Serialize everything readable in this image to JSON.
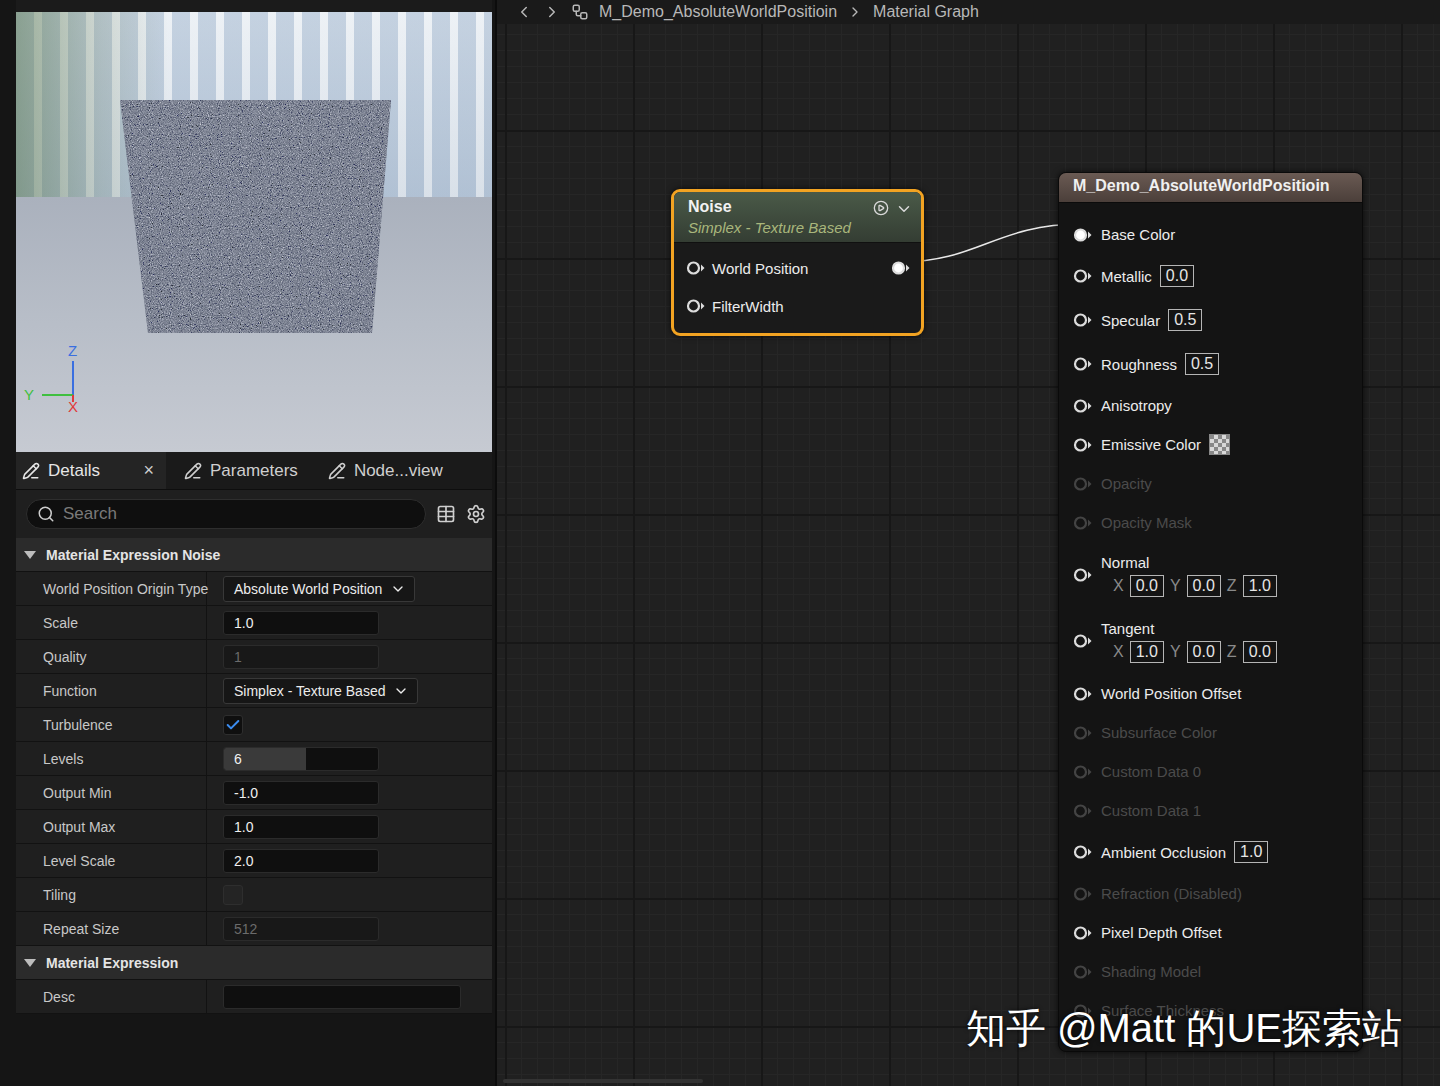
{
  "viewport": {
    "axes": [
      {
        "label": "Z",
        "color": "#3a6fe0"
      },
      {
        "label": "Y",
        "color": "#3fbf3f"
      },
      {
        "label": "X",
        "color": "#e03a3a"
      }
    ]
  },
  "details": {
    "tabs": [
      {
        "label": "Details",
        "selected": true,
        "close": "×"
      },
      {
        "label": "Parameters",
        "selected": false
      },
      {
        "label": "Node...view",
        "selected": false
      }
    ],
    "search": {
      "placeholder": "Search"
    },
    "sections": [
      {
        "title": "Material Expression Noise",
        "expanded": true,
        "rows": [
          {
            "label": "World Position Origin Type",
            "kind": "dropdown",
            "value": "Absolute World Position",
            "disabled": false
          },
          {
            "label": "Scale",
            "kind": "number",
            "value": "1.0",
            "disabled": false
          },
          {
            "label": "Quality",
            "kind": "number",
            "value": "1",
            "disabled": true
          },
          {
            "label": "Function",
            "kind": "dropdown",
            "value": "Simplex - Texture Based",
            "disabled": false
          },
          {
            "label": "Turbulence",
            "kind": "checkbox",
            "checked": true,
            "disabled": false
          },
          {
            "label": "Levels",
            "kind": "slider",
            "value": "6",
            "level": 0.53,
            "disabled": false
          },
          {
            "label": "Output Min",
            "kind": "number",
            "value": "-1.0",
            "disabled": false
          },
          {
            "label": "Output Max",
            "kind": "number",
            "value": "1.0",
            "disabled": false
          },
          {
            "label": "Level Scale",
            "kind": "number",
            "value": "2.0",
            "disabled": false
          },
          {
            "label": "Tiling",
            "kind": "checkbox",
            "checked": false,
            "disabled": true
          },
          {
            "label": "Repeat Size",
            "kind": "number",
            "value": "512",
            "disabled": true
          }
        ]
      },
      {
        "title": "Material Expression",
        "expanded": true,
        "rows": [
          {
            "label": "Desc",
            "kind": "text",
            "value": "",
            "disabled": false
          }
        ]
      }
    ]
  },
  "graph": {
    "breadcrumb": [
      "M_Demo_AbsoluteWorldPositioin",
      "Material Graph"
    ],
    "noise_node": {
      "title": "Noise",
      "subtitle": "Simplex - Texture Based",
      "selected": true,
      "inputs": [
        {
          "label": "World Position",
          "connected": false
        },
        {
          "label": "FilterWidth",
          "connected": false
        }
      ],
      "output": {
        "connected": true
      }
    },
    "result_node": {
      "title": "M_Demo_AbsoluteWorldPositioin",
      "pins": [
        {
          "label": "Base Color",
          "kind": "plain",
          "connected": true,
          "disabled": false
        },
        {
          "label": "Metallic",
          "kind": "value",
          "value": "0.0",
          "connected": false,
          "disabled": false
        },
        {
          "label": "Specular",
          "kind": "value",
          "value": "0.5",
          "connected": false,
          "disabled": false
        },
        {
          "label": "Roughness",
          "kind": "value",
          "value": "0.5",
          "connected": false,
          "disabled": false
        },
        {
          "label": "Anisotropy",
          "kind": "plain",
          "connected": false,
          "disabled": false
        },
        {
          "label": "Emissive Color",
          "kind": "swatch",
          "connected": false,
          "disabled": false
        },
        {
          "label": "Opacity",
          "kind": "plain",
          "connected": false,
          "disabled": true
        },
        {
          "label": "Opacity Mask",
          "kind": "plain",
          "connected": false,
          "disabled": true
        },
        {
          "label": "Normal",
          "kind": "vector",
          "connected": false,
          "disabled": false,
          "components": [
            {
              "axis": "X",
              "value": "0.0"
            },
            {
              "axis": "Y",
              "value": "0.0"
            },
            {
              "axis": "Z",
              "value": "1.0"
            }
          ]
        },
        {
          "label": "Tangent",
          "kind": "vector",
          "connected": false,
          "disabled": false,
          "components": [
            {
              "axis": "X",
              "value": "1.0"
            },
            {
              "axis": "Y",
              "value": "0.0"
            },
            {
              "axis": "Z",
              "value": "0.0"
            }
          ]
        },
        {
          "label": "World Position Offset",
          "kind": "plain",
          "connected": false,
          "disabled": false
        },
        {
          "label": "Subsurface Color",
          "kind": "plain",
          "connected": false,
          "disabled": true
        },
        {
          "label": "Custom Data 0",
          "kind": "plain",
          "connected": false,
          "disabled": true
        },
        {
          "label": "Custom Data 1",
          "kind": "plain",
          "connected": false,
          "disabled": true
        },
        {
          "label": "Ambient Occlusion",
          "kind": "value",
          "value": "1.0",
          "connected": false,
          "disabled": false
        },
        {
          "label": "Refraction (Disabled)",
          "kind": "plain",
          "connected": false,
          "disabled": true
        },
        {
          "label": "Pixel Depth Offset",
          "kind": "plain",
          "connected": false,
          "disabled": false
        },
        {
          "label": "Shading Model",
          "kind": "plain",
          "connected": false,
          "disabled": true
        },
        {
          "label": "Surface Thickness",
          "kind": "plain",
          "connected": false,
          "disabled": true
        }
      ]
    }
  },
  "watermark": "知乎 @Matt 的UE探索站"
}
